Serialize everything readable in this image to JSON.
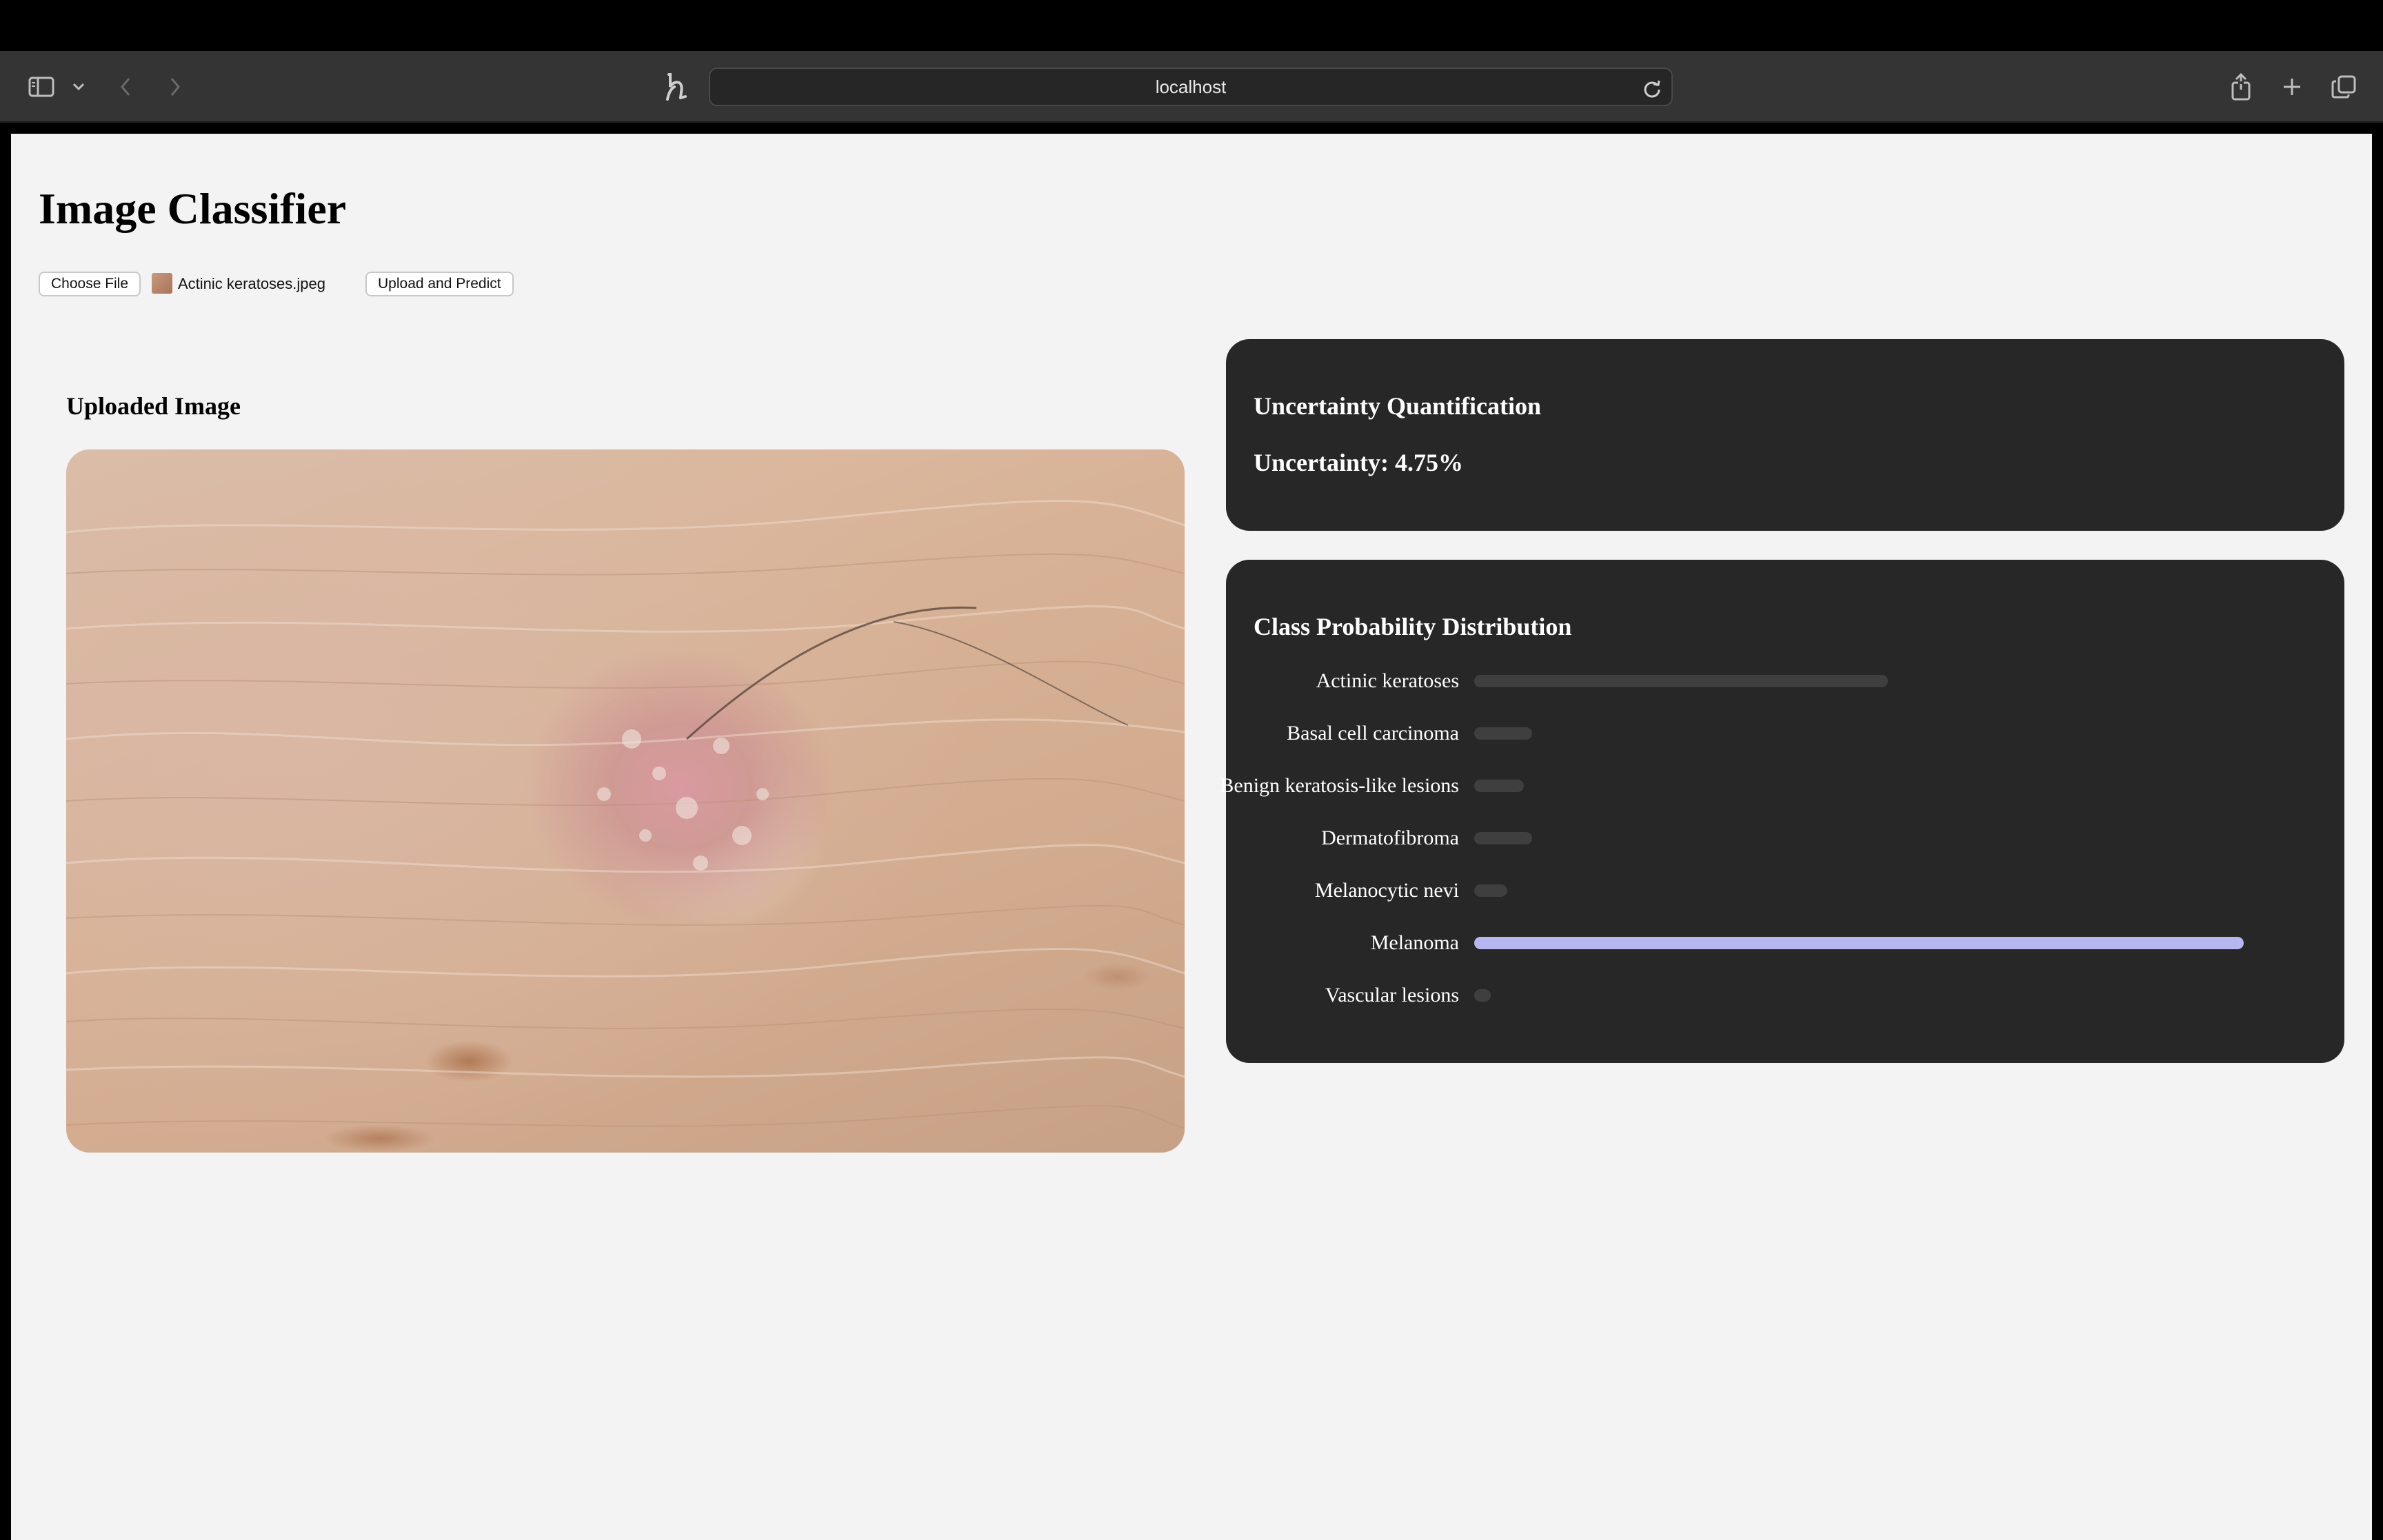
{
  "browser": {
    "url": "localhost",
    "icons": [
      "sidebar-icon",
      "chevron-down-icon",
      "back-icon",
      "forward-icon",
      "extension-icon",
      "reload-icon",
      "share-icon",
      "new-tab-icon",
      "tabs-overview-icon"
    ]
  },
  "page": {
    "title": "Image Classifier",
    "choose_file_label": "Choose File",
    "file_name": "Actinic keratoses.jpeg",
    "upload_label": "Upload and Predict",
    "uploaded_heading": "Uploaded Image"
  },
  "uncertainty": {
    "heading": "Uncertainty Quantification",
    "value_text": "Uncertainty: 4.75%"
  },
  "distribution": {
    "heading": "Class Probability Distribution",
    "bar_color": "#3f3f3f",
    "top_bar_color": "#b6b6f0",
    "classes": [
      {
        "label": "Actinic keratoses",
        "fraction": 0.5
      },
      {
        "label": "Basal cell carcinoma",
        "fraction": 0.07
      },
      {
        "label": "Benign keratosis-like lesions",
        "fraction": 0.06
      },
      {
        "label": "Dermatofibroma",
        "fraction": 0.07
      },
      {
        "label": "Melanocytic nevi",
        "fraction": 0.04
      },
      {
        "label": "Melanoma",
        "fraction": 0.93,
        "highlight": true
      },
      {
        "label": "Vascular lesions",
        "fraction": 0.02
      }
    ]
  }
}
